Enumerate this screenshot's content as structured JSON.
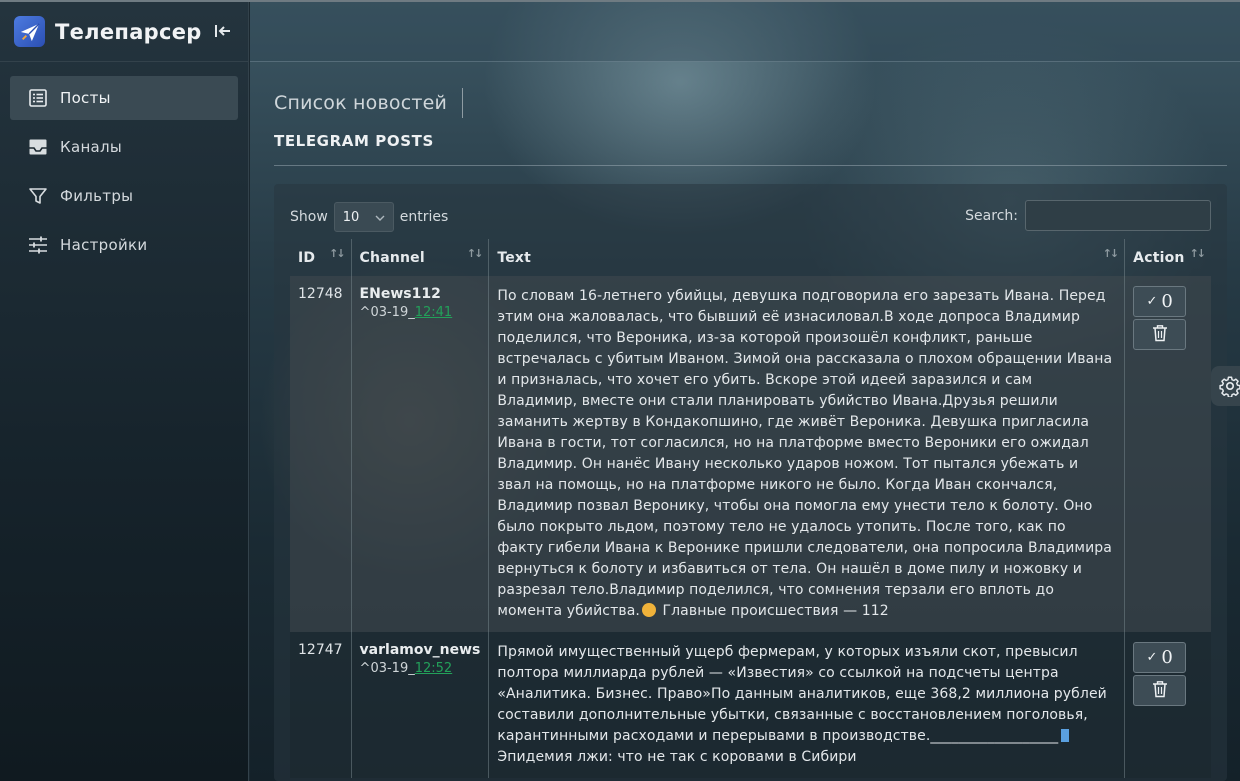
{
  "app": {
    "title": "Телепарсер",
    "logo_icon": "paper-plane-icon",
    "collapse_icon": "collapse-sidebar-icon"
  },
  "sidebar": {
    "items": [
      {
        "label": "Посты",
        "icon": "list-icon",
        "active": true
      },
      {
        "label": "Каналы",
        "icon": "inbox-icon",
        "active": false
      },
      {
        "label": "Фильтры",
        "icon": "filter-icon",
        "active": false
      },
      {
        "label": "Настройки",
        "icon": "sliders-icon",
        "active": false
      }
    ]
  },
  "page": {
    "title": "Список новостей",
    "section_title": "TELEGRAM POSTS"
  },
  "table_controls": {
    "show_label": "Show",
    "entries_value": "10",
    "entries_label": "entries",
    "search_label": "Search:",
    "search_value": ""
  },
  "table": {
    "columns": [
      "ID",
      "Channel",
      "Text",
      "Action"
    ],
    "rows": [
      {
        "id": "12748",
        "channel": "ENews112",
        "date_prefix": "^03-19_",
        "time": "12:41",
        "text_before_emoji": "По словам 16-летнего убийцы, девушка подговорила его зарезать Ивана. Перед этим она жаловалась, что бывший её изнасиловал.В ходе допроса Владимир поделился, что Вероника, из-за которой произошёл конфликт, раньше встречалась с убитым Иваном. Зимой она рассказала о плохом обращении Ивана и призналась, что хочет его убить. Вскоре этой идеей заразился и сам Владимир, вместе они стали планировать убийство Ивана.Друзья решили заманить жертву в Кондакопшино, где живёт Вероника. Девушка пригласила Ивана в гости, тот согласился, но на платформе вместо Вероники его ожидал Владимир. Он нанёс Ивану несколько ударов ножом. Тот пытался убежать и звал на помощь, но на платформе никого не было. Когда Иван скончался, Владимир позвал Веронику, чтобы она помогла ему унести тело к болоту. Оно было покрыто льдом, поэтому тело не удалось утопить. После того, как по факту гибели Ивана к Веронике пришли следователи, она попросила Владимира вернуться к болоту и избавиться от тела. Он нашёл в доме пилу и ножовку и разрезал тело.Владимир поделился, что сомнения терзали его вплоть до момента убийства.",
        "text_after_emoji": " Главные происшествия — 112",
        "approve_label": "0"
      },
      {
        "id": "12747",
        "channel": "varlamov_news",
        "date_prefix": "^03-19_",
        "time": "12:52",
        "text_before_emoji": "Прямой имущественный ущерб фермерам, у которых изъяли скот, превысил полтора миллиарда рублей — «Известия» со ссылкой на подсчеты центра «Аналитика. Бизнес. Право»По данным аналитиков, еще 368,2 миллиона рублей составили дополнительные убытки, связанные с восстановлением поголовья, карантинными расходами и перерывами в производстве.__________________",
        "text_after_emoji": " Эпидемия лжи: что не так с коровами в Сибири",
        "approve_label": "0"
      }
    ]
  },
  "colors": {
    "accent_link": "#23a05a",
    "sidebar_bg": "#1a2a33",
    "active_item_bg": "#3a4a53"
  }
}
